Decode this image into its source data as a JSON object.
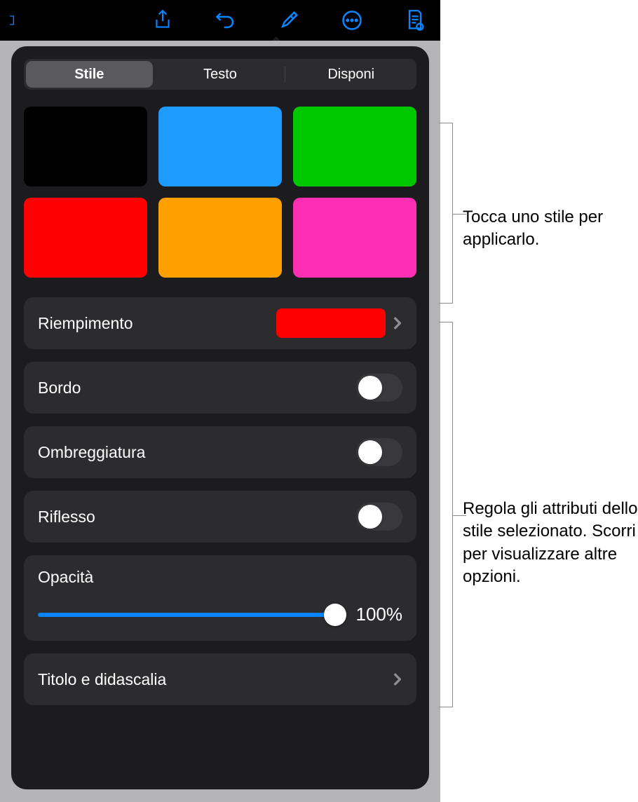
{
  "toolbar": {
    "icons": [
      "share-icon",
      "undo-icon",
      "paintbrush-icon",
      "more-icon",
      "document-settings-icon"
    ]
  },
  "segmented": {
    "tabs": [
      "Stile",
      "Testo",
      "Disponi"
    ],
    "selected": 0
  },
  "presets": {
    "colors": [
      "#000000",
      "#1e9bff",
      "#00c800",
      "#ff0000",
      "#ffa000",
      "#ff2fb3"
    ]
  },
  "rows": {
    "fill": {
      "label": "Riempimento",
      "color": "#ff0000"
    },
    "border": {
      "label": "Bordo",
      "on": false
    },
    "shadow": {
      "label": "Ombreggiatura",
      "on": false
    },
    "reflection": {
      "label": "Riflesso",
      "on": false
    },
    "opacity": {
      "label": "Opacità",
      "value": "100%",
      "percent": 100
    },
    "caption": {
      "label": "Titolo e didascalia"
    }
  },
  "callouts": {
    "c1": "Tocca uno stile per applicarlo.",
    "c2": "Regola gli attributi dello stile selezionato. Scorri per visualizzare altre opzioni."
  }
}
